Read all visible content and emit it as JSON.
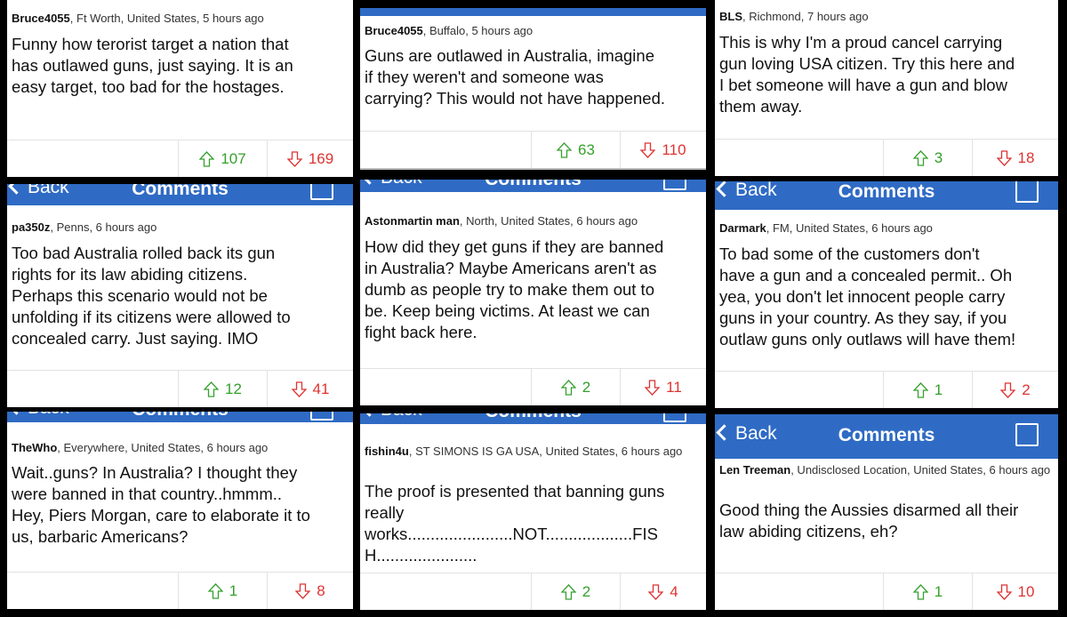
{
  "nav": {
    "back": "Back",
    "title": "Comments"
  },
  "comments": [
    {
      "user": "Bruce4055",
      "location": ", Ft Worth, United States, 5 hours ago",
      "text": [
        "Funny how terorist target a nation that",
        "has outlawed guns, just saying. It is an",
        "easy target, too bad for the hostages."
      ],
      "up": "107",
      "down": "169"
    },
    {
      "user": "Bruce4055",
      "location": ", Buffalo, 5 hours ago",
      "text": [
        "Guns are outlawed in Australia, imagine",
        "if they weren't and someone was",
        "carrying? This would not have happened."
      ],
      "up": "63",
      "down": "110"
    },
    {
      "user": "BLS",
      "location": ", Richmond, 7 hours ago",
      "text": [
        "This is why I'm a proud cancel carrying",
        "gun loving USA citizen. Try this here and",
        "I bet someone will have a gun and blow",
        "them away."
      ],
      "up": "3",
      "down": "18"
    },
    {
      "user": "pa350z",
      "location": ", Penns, 6 hours ago",
      "text": [
        "Too bad Australia rolled back its gun",
        "rights for its law abiding citizens.",
        "Perhaps this scenario would not be",
        "unfolding if its citizens were allowed to",
        "concealed carry. Just saying. IMO"
      ],
      "up": "12",
      "down": "41"
    },
    {
      "user": "Astonmartin man",
      "location": ", North, United States, 6 hours ago",
      "text": [
        "How did they get guns if they are banned",
        "in Australia? Maybe Americans aren't as",
        "dumb as people try to make them out to",
        "be. Keep being victims. At least we can",
        "fight back here."
      ],
      "up": "2",
      "down": "11"
    },
    {
      "user": "Darmark",
      "location": ", FM, United States, 6 hours ago",
      "text": [
        "To bad some of the customers don't",
        "have a gun and a concealed permit.. Oh",
        "yea, you don't let innocent people carry",
        "guns in your country.  As they say, if you",
        "outlaw guns only outlaws will have them!"
      ],
      "up": "1",
      "down": "2"
    },
    {
      "user": "TheWho",
      "location": ", Everywhere, United States, 6 hours ago",
      "text": [
        "Wait..guns? In Australia? I thought they",
        "were banned in that country..hmmm..",
        "Hey, Piers Morgan, care to elaborate it to",
        "us, barbaric Americans?"
      ],
      "up": "1",
      "down": "8"
    },
    {
      "user": "fishin4u",
      "location": ", ST SIMONS IS GA USA, United States, 6 hours ago",
      "text": [
        "The proof is presented that banning guns",
        "really",
        "works.......................NOT...................FIS",
        "H......................"
      ],
      "up": "2",
      "down": "4"
    },
    {
      "user": "Len Treeman",
      "location": ", Undisclosed Location, United States, 6 hours ago",
      "text": [
        "Good thing the Aussies disarmed all their",
        "law abiding citizens, eh?"
      ],
      "up": "1",
      "down": "10"
    }
  ],
  "colors": {
    "nav": "#2f6bc4",
    "up": "#35a02c",
    "down": "#d33333"
  }
}
